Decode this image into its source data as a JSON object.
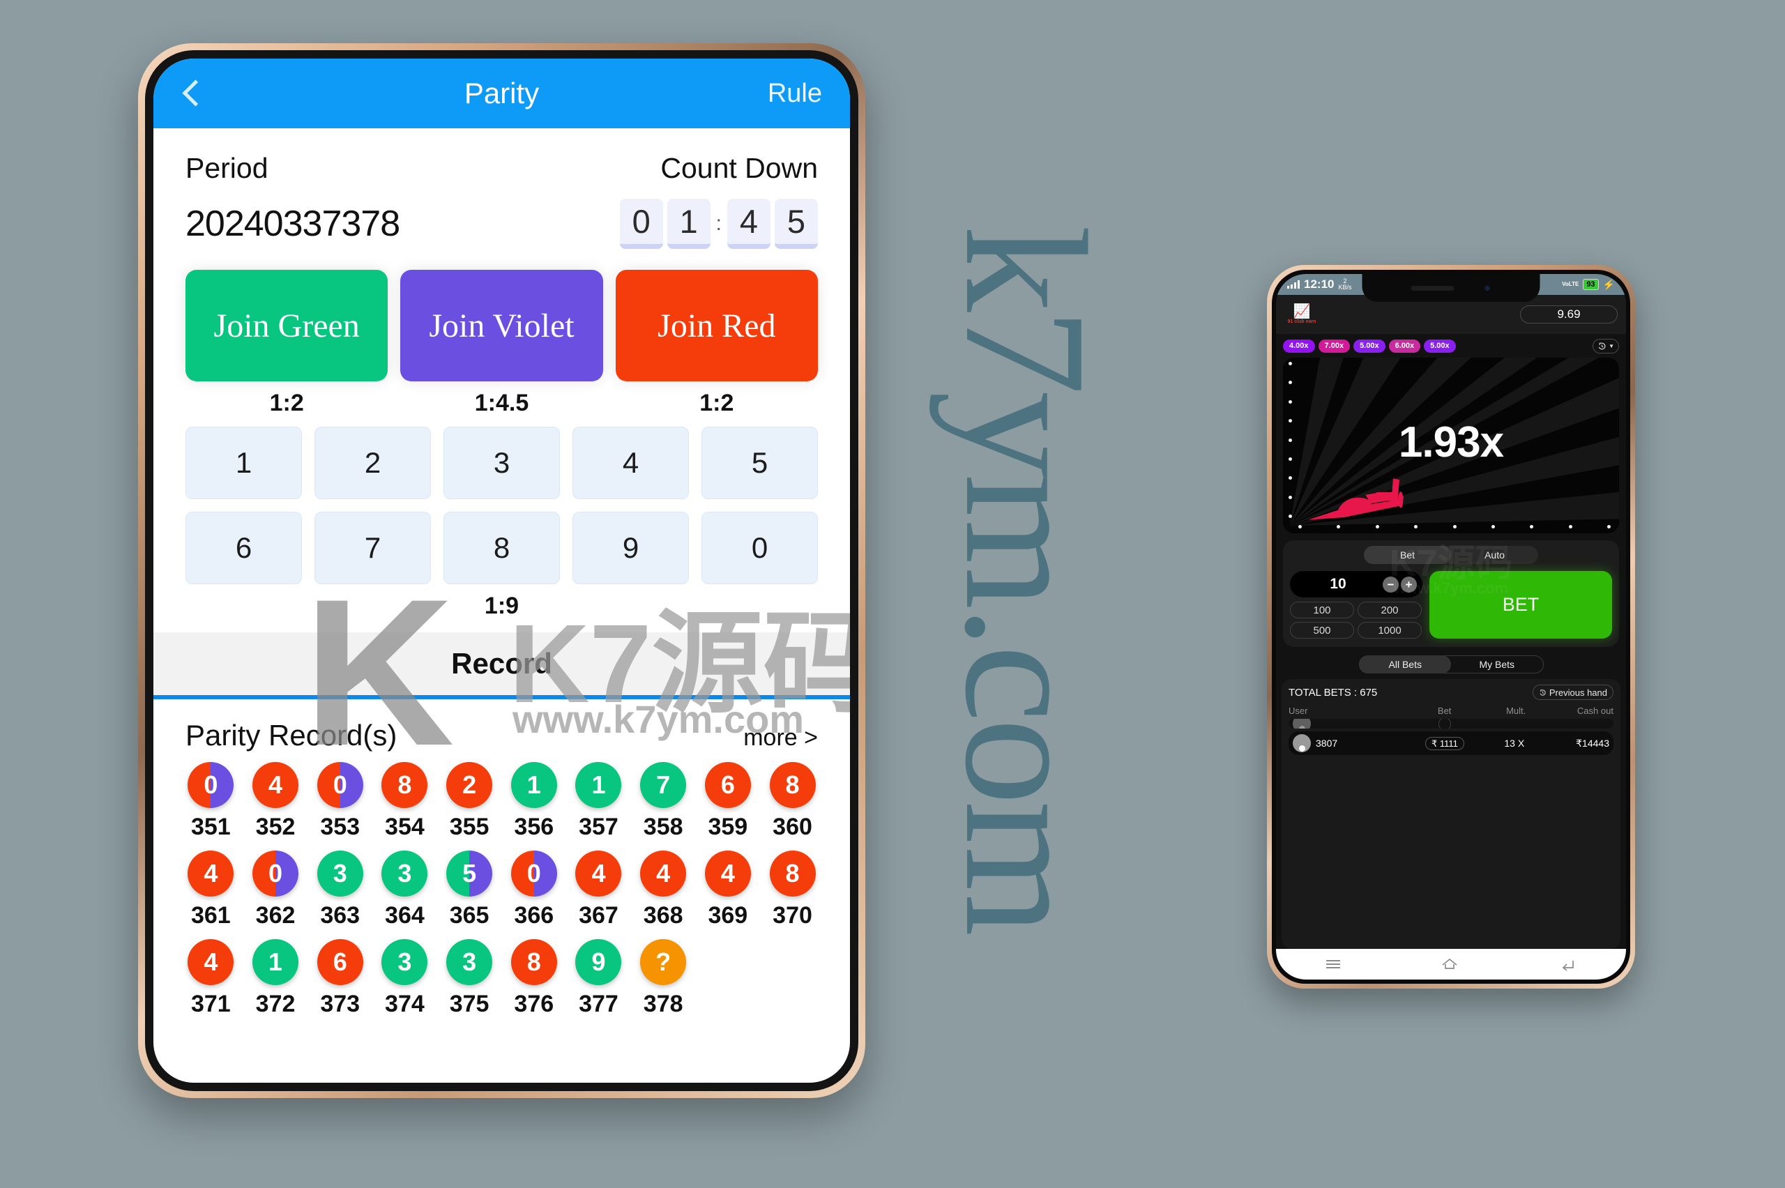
{
  "background": {
    "color": "#8c9ca1",
    "watermark_text": "k7ym.com",
    "watermark_color": "#4d7380"
  },
  "parity_phone": {
    "header": {
      "back_icon": "chevron-left-icon",
      "title": "Parity",
      "rule_label": "Rule"
    },
    "period": {
      "period_label": "Period",
      "period_value": "20240337378",
      "countdown_label": "Count Down",
      "countdown_digits": [
        "0",
        "1",
        "4",
        "5"
      ],
      "countdown_separator": ":"
    },
    "join_buttons": [
      {
        "label": "Join Green",
        "ratio": "1:2",
        "color": "#08c580"
      },
      {
        "label": "Join Violet",
        "ratio": "1:4.5",
        "color": "#6b4fe0"
      },
      {
        "label": "Join Red",
        "ratio": "1:2",
        "color": "#f53d0b"
      }
    ],
    "number_grid": {
      "row1": [
        "1",
        "2",
        "3",
        "4",
        "5"
      ],
      "row2": [
        "6",
        "7",
        "8",
        "9",
        "0"
      ],
      "ratio": "1:9"
    },
    "overlay_watermark": {
      "logo_letter": "K",
      "brand": "K7源码",
      "url": "www.k7ym.com"
    },
    "record": {
      "tab_label": "Record",
      "section_title": "Parity Record(s)",
      "more_label": "more >",
      "rows": [
        [
          {
            "seq": "351",
            "value": "0",
            "style": "red-violet"
          },
          {
            "seq": "352",
            "value": "4",
            "style": "red"
          },
          {
            "seq": "353",
            "value": "0",
            "style": "red-violet"
          },
          {
            "seq": "354",
            "value": "8",
            "style": "red"
          },
          {
            "seq": "355",
            "value": "2",
            "style": "red"
          },
          {
            "seq": "356",
            "value": "1",
            "style": "green"
          },
          {
            "seq": "357",
            "value": "1",
            "style": "green"
          },
          {
            "seq": "358",
            "value": "7",
            "style": "green"
          },
          {
            "seq": "359",
            "value": "6",
            "style": "red"
          },
          {
            "seq": "360",
            "value": "8",
            "style": "red"
          }
        ],
        [
          {
            "seq": "361",
            "value": "4",
            "style": "red"
          },
          {
            "seq": "362",
            "value": "0",
            "style": "red-violet"
          },
          {
            "seq": "363",
            "value": "3",
            "style": "green"
          },
          {
            "seq": "364",
            "value": "3",
            "style": "green"
          },
          {
            "seq": "365",
            "value": "5",
            "style": "green-violet"
          },
          {
            "seq": "366",
            "value": "0",
            "style": "red-violet"
          },
          {
            "seq": "367",
            "value": "4",
            "style": "red"
          },
          {
            "seq": "368",
            "value": "4",
            "style": "red"
          },
          {
            "seq": "369",
            "value": "4",
            "style": "red"
          },
          {
            "seq": "370",
            "value": "8",
            "style": "red"
          }
        ],
        [
          {
            "seq": "371",
            "value": "4",
            "style": "red"
          },
          {
            "seq": "372",
            "value": "1",
            "style": "green"
          },
          {
            "seq": "373",
            "value": "6",
            "style": "red"
          },
          {
            "seq": "374",
            "value": "3",
            "style": "green"
          },
          {
            "seq": "375",
            "value": "3",
            "style": "green"
          },
          {
            "seq": "376",
            "value": "8",
            "style": "red"
          },
          {
            "seq": "377",
            "value": "9",
            "style": "green"
          },
          {
            "seq": "378",
            "value": "?",
            "style": "orange"
          }
        ]
      ],
      "ball_colors": {
        "red": "#f53d0b",
        "green": "#08c580",
        "violet": "#6b4fe0",
        "orange": "#f59300"
      }
    }
  },
  "aviator_phone": {
    "statusbar": {
      "time": "12:10",
      "data_rate_value": "2",
      "data_rate_unit": "KB/s",
      "network": "VoLTE",
      "battery": "93",
      "charging_icon": "bolt-icon",
      "signal_icon": "signal-bars-icon"
    },
    "game_top": {
      "logo_icon": "chart-arrow-icon",
      "logo_text": "91 club earn",
      "balance": "9.69"
    },
    "multiplier_history": [
      {
        "label": "4.00x",
        "color": "#9212f0"
      },
      {
        "label": "7.00x",
        "color": "#d31b9a"
      },
      {
        "label": "5.00x",
        "color": "#8a20ef"
      },
      {
        "label": "6.00x",
        "color": "#c92a9e"
      },
      {
        "label": "5.00x",
        "color": "#8a20ef"
      }
    ],
    "history_button_icon": "history-clock-icon",
    "stage": {
      "current_multiplier": "1.93x",
      "plane_icon": "airplane-icon",
      "plane_color": "#e8174b"
    },
    "bet_panel": {
      "tabs": [
        {
          "label": "Bet",
          "active": true
        },
        {
          "label": "Auto",
          "active": false
        }
      ],
      "amount": "10",
      "decrement_icon": "minus-icon",
      "increment_icon": "plus-icon",
      "quick_amounts": [
        "100",
        "200",
        "500",
        "1000"
      ],
      "cta_label": "BET",
      "cta_color": "#2fb806",
      "watermark": {
        "brand": "K7源码",
        "url": "www.k7ym.com"
      }
    },
    "bets_section": {
      "tabs": [
        {
          "label": "All Bets",
          "active": true
        },
        {
          "label": "My Bets",
          "active": false
        }
      ],
      "total_bets_label": "TOTAL BETS : 675",
      "previous_hand_label": "Previous hand",
      "previous_hand_icon": "history-clock-icon",
      "columns": [
        "User",
        "Bet",
        "Mult.",
        "Cash out"
      ],
      "rows": [
        {
          "user": "3807",
          "bet": "₹ 1111",
          "mult": "13 X",
          "cashout": "₹14443",
          "avatar_icon": "user-avatar-icon"
        }
      ]
    },
    "navbar": {
      "menu_icon": "menu-icon",
      "home_icon": "home-icon",
      "back_icon": "back-arrow-icon"
    }
  }
}
